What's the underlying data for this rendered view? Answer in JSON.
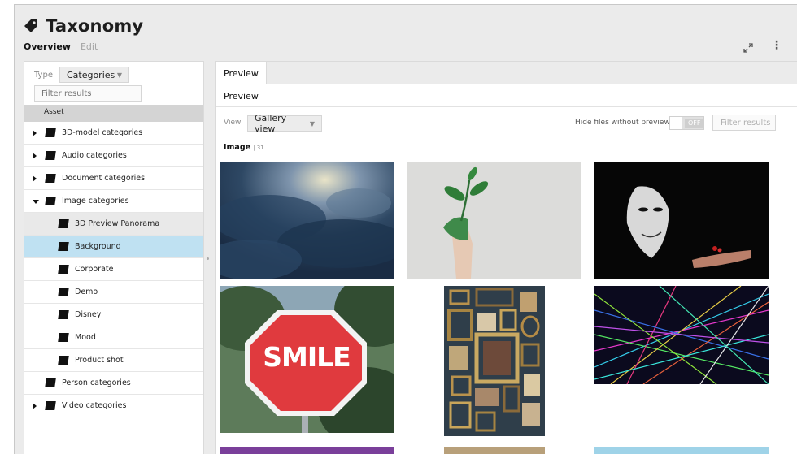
{
  "header": {
    "title": "Taxonomy",
    "tabs": [
      {
        "label": "Overview",
        "active": true
      },
      {
        "label": "Edit",
        "active": false
      }
    ],
    "icons": [
      "tag-icon",
      "expand-icon",
      "kebab-menu-icon"
    ]
  },
  "left_panel": {
    "type_label": "Type",
    "type_value": "Categories",
    "filter_placeholder": "Filter results",
    "asset_header": "Asset",
    "tree": [
      {
        "label": "3D-model categories",
        "level": 0,
        "expandable": true,
        "expanded": false
      },
      {
        "label": "Audio categories",
        "level": 0,
        "expandable": true,
        "expanded": false
      },
      {
        "label": "Document categories",
        "level": 0,
        "expandable": true,
        "expanded": false
      },
      {
        "label": "Image categories",
        "level": 0,
        "expandable": true,
        "expanded": true
      },
      {
        "label": "3D Preview Panorama",
        "level": 1,
        "hovered": true
      },
      {
        "label": "Background",
        "level": 1,
        "selected": true
      },
      {
        "label": "Corporate",
        "level": 1
      },
      {
        "label": "Demo",
        "level": 1
      },
      {
        "label": "Disney",
        "level": 1
      },
      {
        "label": "Mood",
        "level": 1
      },
      {
        "label": "Product shot",
        "level": 1
      },
      {
        "label": "Person categories",
        "level": 0,
        "expandable": false
      },
      {
        "label": "Video categories",
        "level": 0,
        "expandable": true,
        "expanded": false
      }
    ]
  },
  "right_panel": {
    "tab_label": "Preview",
    "section_title": "Preview",
    "view_label": "View",
    "view_value": "Gallery view",
    "hide_label": "Hide files without preview",
    "toggle_text": "OFF",
    "filter_label": "Filter results",
    "image_heading": "Image",
    "image_count": "31",
    "thumbnails": [
      {
        "name": "storm-clouds-thumbnail"
      },
      {
        "name": "plant-hand-thumbnail"
      },
      {
        "name": "mask-thumbnail"
      },
      {
        "name": "smile-sign-thumbnail",
        "text": "SMILE"
      },
      {
        "name": "picture-frames-thumbnail"
      },
      {
        "name": "laser-lights-thumbnail"
      }
    ]
  },
  "colors": {
    "frame_bg": "#ebebeb",
    "selected_row": "#bfe1f2",
    "stop_sign_red": "#e03a3e"
  }
}
